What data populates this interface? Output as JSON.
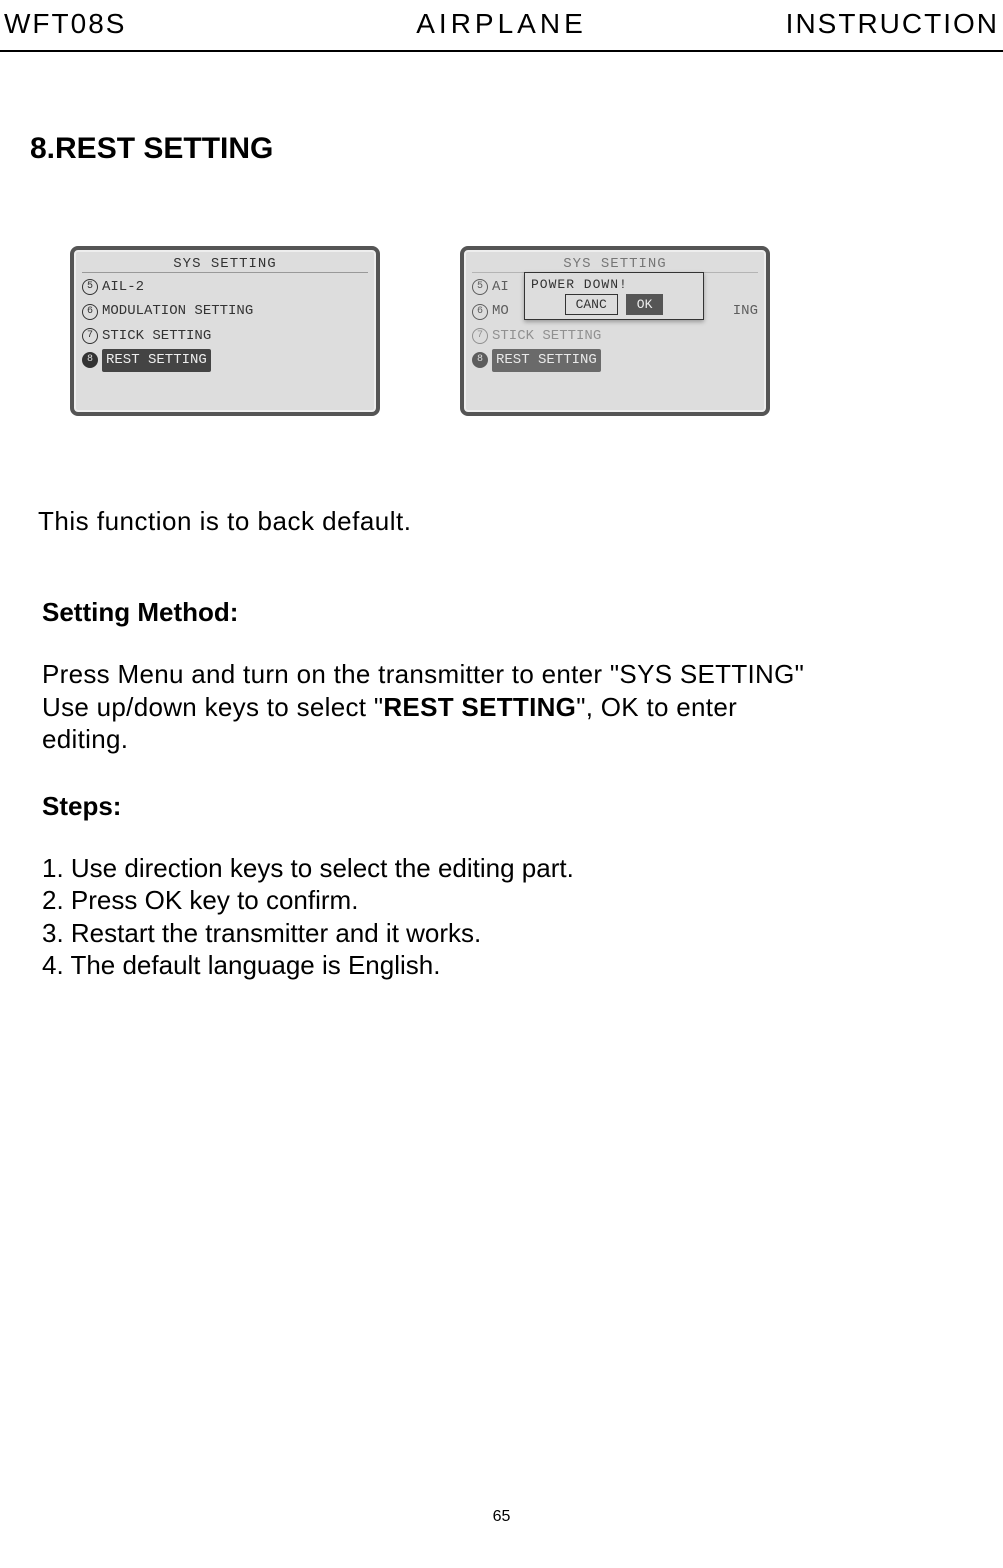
{
  "header": {
    "left": "WFT08S",
    "center": "AIRPLANE",
    "right": "INSTRUCTION"
  },
  "section_title": "8.REST SETTING",
  "screen1": {
    "title": "SYS SETTING",
    "items": [
      {
        "num": "5",
        "label": "AIL-2",
        "filled": false
      },
      {
        "num": "6",
        "label": "MODULATION SETTING",
        "filled": false
      },
      {
        "num": "7",
        "label": "STICK SETTING",
        "filled": false
      },
      {
        "num": "8",
        "label": "REST SETTING",
        "filled": true,
        "selected": true
      }
    ]
  },
  "screen2": {
    "title": "SYS SETTING",
    "items": [
      {
        "num": "5",
        "label_short": "AI",
        "tail": "",
        "filled": false
      },
      {
        "num": "6",
        "label_short": "MO",
        "tail": "ING",
        "filled": false
      },
      {
        "num": "7",
        "label_short": "STICK SETTING",
        "tail": "",
        "filled": false,
        "dim": true
      },
      {
        "num": "8",
        "label_short": "REST SETTING",
        "tail": "",
        "filled": true,
        "selected": true
      }
    ],
    "popup": {
      "title": "POWER DOWN!",
      "cancel": "CANC",
      "ok": "OK"
    }
  },
  "description": "This function is to back default.",
  "method": {
    "title": "Setting Method:",
    "line1": "Press Menu and turn on the transmitter to enter \"SYS SETTING\"",
    "line2a": "Use up/down keys to select \"",
    "line2b": "REST SETTING",
    "line2c": "\", OK to enter",
    "line3": "editing."
  },
  "steps": {
    "title": "Steps:",
    "items": [
      "1. Use direction keys to select the editing part.",
      "2. Press OK  key to confirm.",
      "3. Restart the transmitter and it  works.",
      "4. The  default  language  is  English."
    ]
  },
  "page_number": "65"
}
